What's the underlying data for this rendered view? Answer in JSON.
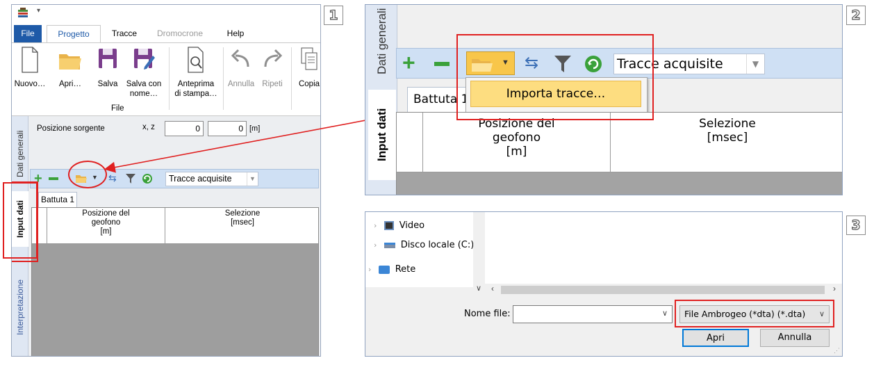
{
  "step_numbers": [
    "1",
    "2",
    "3"
  ],
  "panel1": {
    "tabs": [
      {
        "label": "File",
        "state": "file"
      },
      {
        "label": "Progetto",
        "state": "active"
      },
      {
        "label": "Tracce",
        "state": "normal"
      },
      {
        "label": "Dromocrone",
        "state": "dim"
      },
      {
        "label": "Help",
        "state": "normal"
      }
    ],
    "ribbon": {
      "nuovo": "Nuovo…",
      "apri": "Apri…",
      "salva": "Salva",
      "salva_con_nome_1": "Salva con",
      "salva_con_nome_2": "nome…",
      "anteprima_1": "Anteprima",
      "anteprima_2": "di stampa…",
      "annulla": "Annulla",
      "ripeti": "Ripeti",
      "copia": "Copia",
      "group_file": "File"
    },
    "side_tabs": {
      "dati_generali": "Dati generali",
      "input_dati": "Input dati",
      "interpretazione": "Interpretazione"
    },
    "posizione_sorgente": "Posizione sorgente",
    "xz_label": "x, z",
    "x_value": "0",
    "z_value": "0",
    "unit_m": "[m]",
    "combo_value": "Tracce acquisite",
    "tab_battuta": "Battuta 1",
    "col_posizione_1": "Posizione del",
    "col_posizione_2": "geofono",
    "col_posizione_3": "[m]",
    "col_selezione_1": "Selezione",
    "col_selezione_2": "[msec]"
  },
  "panel2": {
    "side_tab_top": "Dati generali",
    "side_tab_input": "Input dati",
    "combo_value": "Tracce acquisite",
    "menu_item": "Importa tracce…",
    "tab_battuta": "Battuta 1",
    "col_posizione_1": "Posizione del",
    "col_posizione_2": "geofono",
    "col_posizione_3": "[m]",
    "col_selezione_1": "Selezione",
    "col_selezione_2": "[msec]"
  },
  "panel3": {
    "tree": [
      "Video",
      "Disco locale (C:)",
      "Rete"
    ],
    "nome_file_label": "Nome file:",
    "nome_file_value": "",
    "file_type": "File Ambrogeo (*dta) (*.dta)",
    "apri_button": "Apri",
    "annulla_button": "Annulla"
  },
  "colors": {
    "accent": "#1e5aa8",
    "highlight": "#e02020",
    "toolbar": "#cfe0f4"
  }
}
